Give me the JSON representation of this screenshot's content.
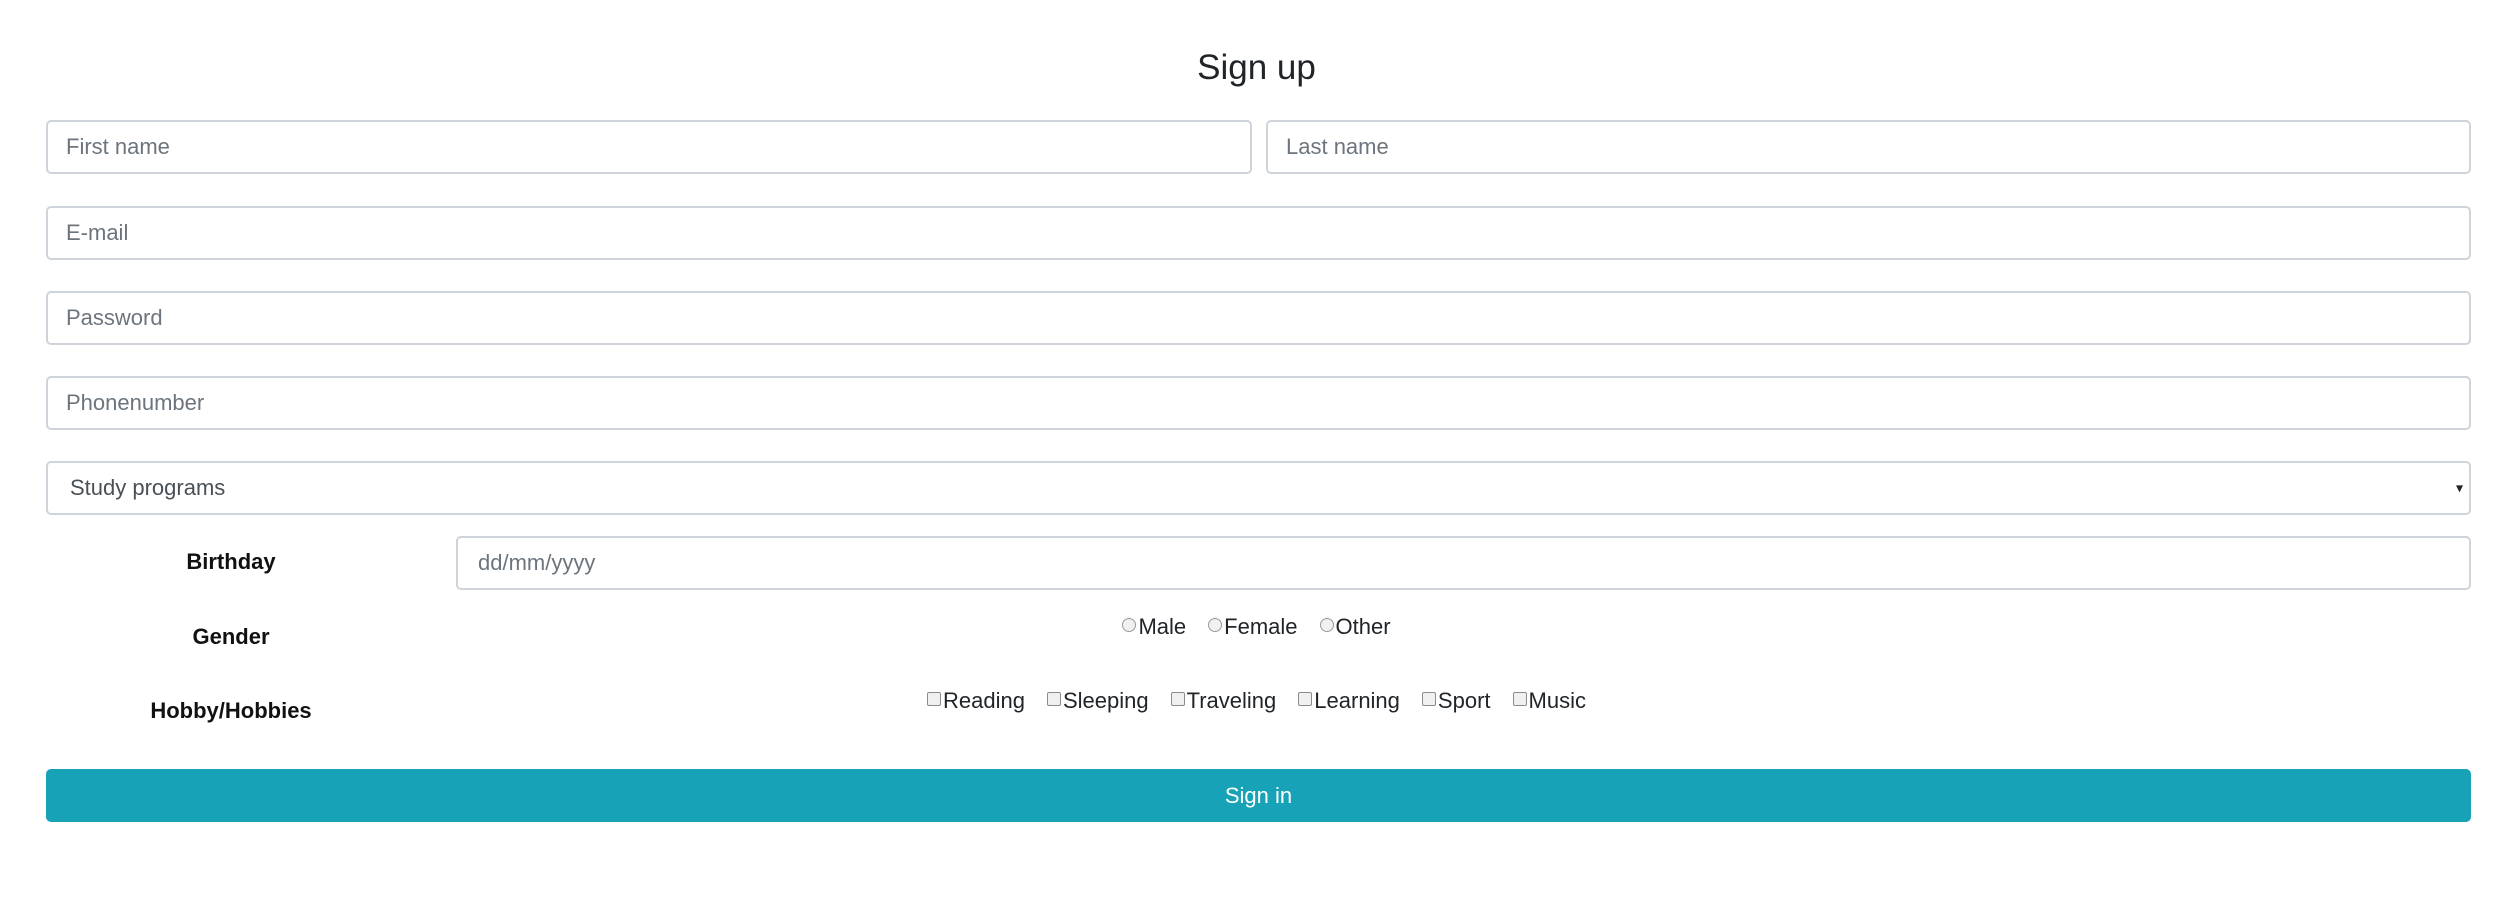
{
  "form": {
    "title": "Sign up",
    "first_name": {
      "placeholder": "First name",
      "value": ""
    },
    "last_name": {
      "placeholder": "Last name",
      "value": ""
    },
    "email": {
      "placeholder": "E-mail",
      "value": ""
    },
    "password": {
      "placeholder": "Password",
      "value": ""
    },
    "phone": {
      "placeholder": "Phonenumber",
      "value": ""
    },
    "study_programs": {
      "selected": "Study programs"
    },
    "birthday": {
      "label": "Birthday",
      "placeholder": "dd/mm/yyyy",
      "value": ""
    },
    "gender": {
      "label": "Gender",
      "options": [
        "Male",
        "Female",
        "Other"
      ]
    },
    "hobbies": {
      "label": "Hobby/Hobbies",
      "options": [
        "Reading",
        "Sleeping",
        "Traveling",
        "Learning",
        "Sport",
        "Music"
      ]
    },
    "submit_label": "Sign in"
  },
  "colors": {
    "submit_background": "#17a2b8",
    "input_border": "#ced4da",
    "placeholder": "#6c757d"
  }
}
